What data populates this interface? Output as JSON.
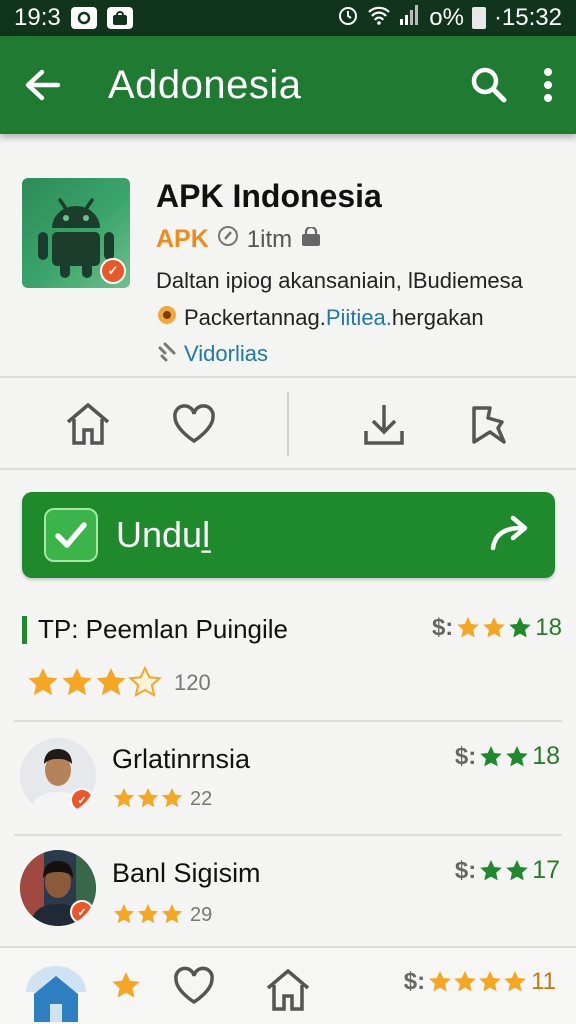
{
  "status_bar": {
    "time_left": "19:3",
    "battery_text": "o%",
    "time_right": "·15:32"
  },
  "app_bar": {
    "title": "Addonesia",
    "icons": [
      "back-arrow-icon",
      "search-icon",
      "more-vert-icon"
    ]
  },
  "app": {
    "name": "APK Indonesia",
    "brand": "APK",
    "meta_text": "1itm",
    "description": "Daltan ipiog akansaniain, lBudiemesa",
    "line2_prefix": "Packertannag.",
    "line2_link": "Piitiea.",
    "line2_suffix": "hergakan",
    "link_text": "Vidorlias"
  },
  "actions": [
    "home-icon",
    "heart-icon",
    "download-icon",
    "bookmark-icon"
  ],
  "download_button": {
    "label": "Unduḻ",
    "color": "#1e8a2c"
  },
  "review_header": {
    "title": "TP: Peemlan Puingile",
    "rating_prefix": "$:",
    "rating_stars": 3,
    "rating_value": "18",
    "stars": 4,
    "count": "120"
  },
  "reviews": [
    {
      "name": "Grlatinrnsia",
      "stars": 3,
      "count": "22",
      "prefix": "$:",
      "right_stars": 2,
      "value": "18"
    },
    {
      "name": "Banl Sigisim",
      "stars": 3,
      "count": "29",
      "prefix": "$:",
      "right_stars": 2,
      "value": "17"
    }
  ],
  "bottom_nav": {
    "items": [
      "home-icon",
      "star-icon",
      "heart-icon",
      "house-outline-icon"
    ],
    "right_prefix": "$:",
    "right_stars": 4,
    "right_value": "11"
  },
  "colors": {
    "app_bar": "#1f7a32",
    "status_bar": "#11351c",
    "star": "#f5a623",
    "green_star": "#1f8a2c"
  }
}
